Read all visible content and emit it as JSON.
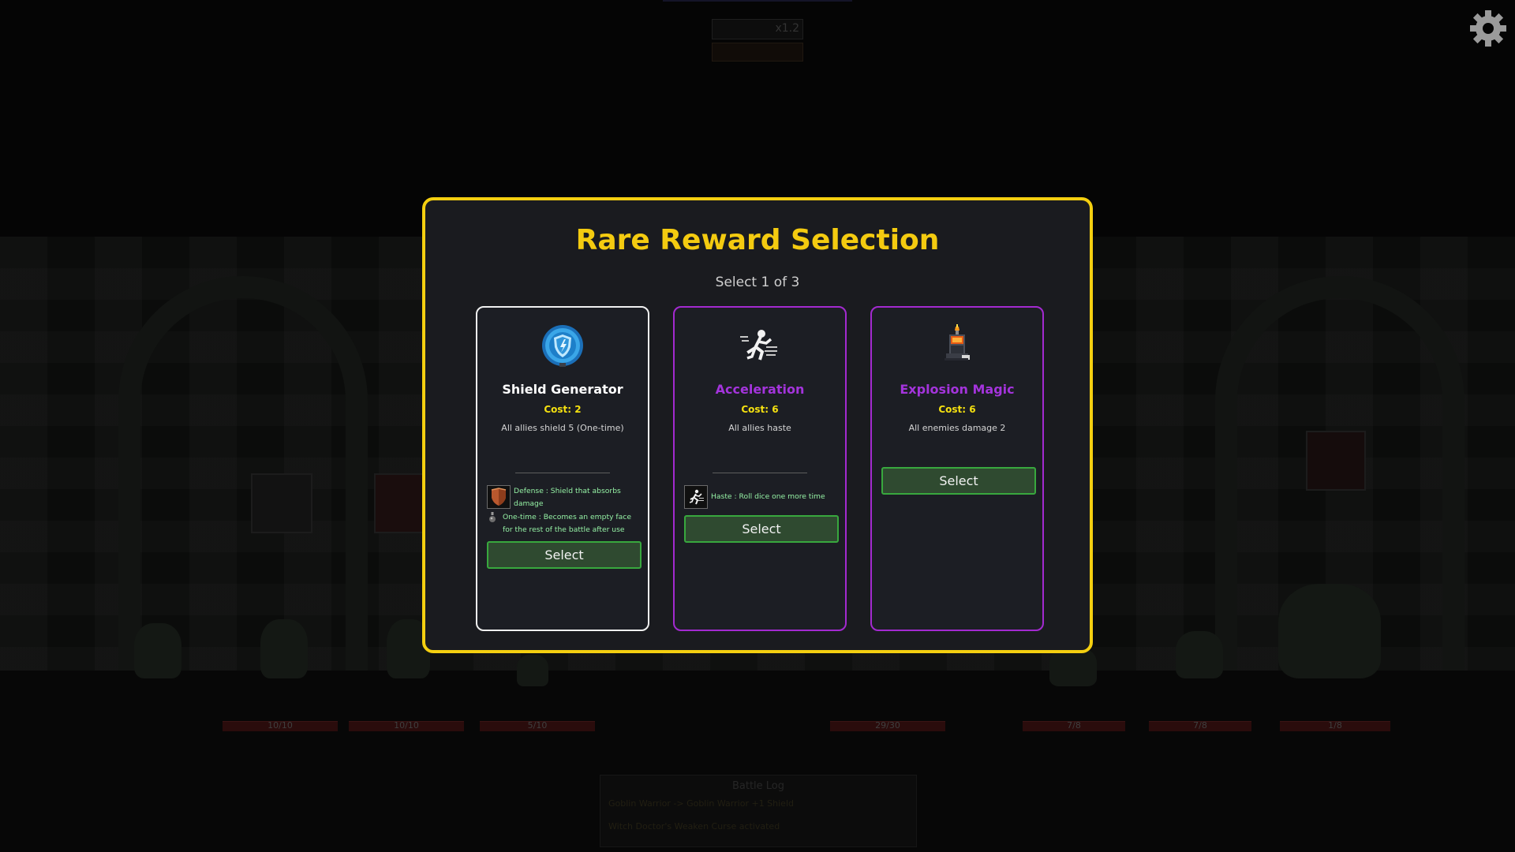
{
  "modal": {
    "title": "Rare Reward Selection",
    "subtitle": "Select 1 of 3",
    "border_color": "#f4cf10"
  },
  "cards": [
    {
      "name": "Shield Generator",
      "cost": "Cost: 2",
      "description": "All allies shield 5 (One-time)",
      "icon": "shield-generator-icon",
      "selected": true,
      "keywords": [
        {
          "icon": "shield-icon",
          "text": "Defense : Shield that absorbs damage"
        },
        {
          "icon": "potion-icon",
          "text": "One-time : Becomes an empty face for the rest of the battle after use"
        }
      ],
      "button_label": "Select"
    },
    {
      "name": "Acceleration",
      "cost": "Cost: 6",
      "description": "All allies haste",
      "icon": "running-figure-icon",
      "selected": false,
      "keywords": [
        {
          "icon": "haste-icon",
          "text": "Haste : Roll dice one more time"
        }
      ],
      "button_label": "Select"
    },
    {
      "name": "Explosion Magic",
      "cost": "Cost: 6",
      "description": "All enemies damage 2",
      "icon": "bomb-icon",
      "selected": false,
      "keywords": [],
      "button_label": "Select"
    }
  ],
  "colors": {
    "rare_purple": "#a32ad0",
    "cost_yellow": "#f4e010",
    "keyword_green": "#94f0a4",
    "button_green": "#38a83e"
  },
  "background": {
    "speed_label": "x1.2",
    "hp_labels": [
      "10/10",
      "10/10",
      "5/10",
      "29/30",
      "7/8",
      "7/8",
      "1/8"
    ],
    "battle_log_title": "Battle Log",
    "battle_log_lines": [
      "Goblin Warrior -> Goblin Warrior +1 Shield",
      "Witch Doctor's Weaken Curse activated"
    ]
  }
}
